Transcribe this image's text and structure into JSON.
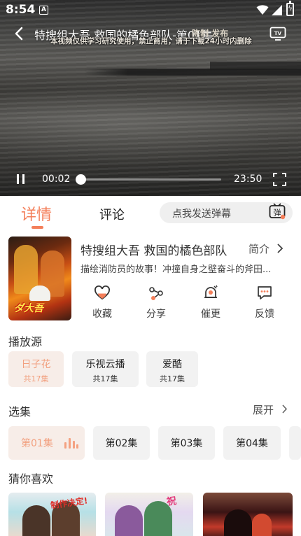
{
  "status_bar": {
    "time": "8:54",
    "notification_icon": "A"
  },
  "video": {
    "title": "特搜组大吾 救国的橘色部队-第01集",
    "credit": "陈制 发布",
    "watermark": "本视频仅供学习研究使用，禁止商用，请于下载24小时内删除",
    "current_time": "00:02",
    "total_time": "23:50",
    "progress": 0.0014
  },
  "tabs": {
    "detail": "详情",
    "comment": "评论",
    "danmaku_placeholder": "点我发送弹幕",
    "danmaku_icon_text": "弹"
  },
  "show": {
    "poster_logo": "ダ大吾",
    "title": "特搜组大吾 救国的橘色部队",
    "intro_label": "简介",
    "description": "描绘消防员的故事！冲撞自身之壁奋斗的斧田..."
  },
  "actions": [
    {
      "icon": "heart-icon",
      "label": "收藏"
    },
    {
      "icon": "share-icon",
      "label": "分享"
    },
    {
      "icon": "bell-icon",
      "label": "催更"
    },
    {
      "icon": "feedback-icon",
      "label": "反馈"
    }
  ],
  "sources": {
    "title": "播放源",
    "items": [
      {
        "name": "日子花",
        "count": "共17集"
      },
      {
        "name": "乐视云播",
        "count": "共17集"
      },
      {
        "name": "爱酷",
        "count": "共17集"
      }
    ]
  },
  "episodes": {
    "title": "选集",
    "expand_label": "展开",
    "items": [
      "第01集",
      "第02集",
      "第03集",
      "第04集"
    ]
  },
  "recommend": {
    "title": "猜你喜欢",
    "tags": [
      "制作决定!",
      "祝",
      ""
    ]
  },
  "colors": {
    "accent": "#f47f5a",
    "active_bg": "#f7ede8",
    "chip_bg": "#f2f2f2"
  }
}
